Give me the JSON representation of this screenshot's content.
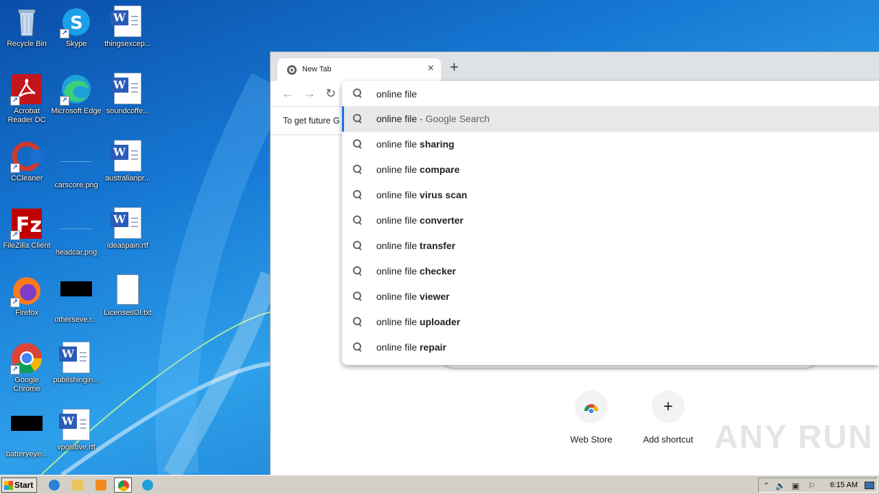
{
  "desktop": {
    "icons": [
      {
        "label": "Recycle Bin",
        "icon": "recycle-bin-icon"
      },
      {
        "label": "Skype",
        "icon": "skype-icon"
      },
      {
        "label": "thingsexcep...",
        "icon": "word-doc-icon"
      },
      {
        "label": "Acrobat Reader DC",
        "icon": "acrobat-icon"
      },
      {
        "label": "Microsoft Edge",
        "icon": "edge-icon"
      },
      {
        "label": "soundcoffe...",
        "icon": "word-doc-icon"
      },
      {
        "label": "CCleaner",
        "icon": "ccleaner-icon"
      },
      {
        "label": "carscore.png",
        "icon": "png-file-icon"
      },
      {
        "label": "australianpr...",
        "icon": "word-doc-icon"
      },
      {
        "label": "FileZilla Client",
        "icon": "filezilla-icon"
      },
      {
        "label": "headcar.png",
        "icon": "png-file-icon"
      },
      {
        "label": "ideaspain.rtf",
        "icon": "word-doc-icon"
      },
      {
        "label": "Firefox",
        "icon": "firefox-icon"
      },
      {
        "label": "otherseve r...",
        "icon": "black-file-icon"
      },
      {
        "label": "LicensesOI.txt",
        "icon": "text-file-icon"
      },
      {
        "label": "Google Chrome",
        "icon": "chrome-icon"
      },
      {
        "label": "publishingin...",
        "icon": "word-doc-icon"
      },
      {
        "label": "batteryeye...",
        "icon": "black-file-icon"
      },
      {
        "label": "vpositive.rtf",
        "icon": "word-doc-icon"
      }
    ]
  },
  "browser": {
    "tab_title": "New Tab",
    "tab_close": "×",
    "new_tab": "+",
    "infobar_text": "To get future G",
    "omnibox_value": "online file",
    "suggestions": [
      {
        "prefix": "online file",
        "bold": "",
        "suffix": " - Google Search"
      },
      {
        "prefix": "online file ",
        "bold": "sharing",
        "suffix": ""
      },
      {
        "prefix": "online file ",
        "bold": "compare",
        "suffix": ""
      },
      {
        "prefix": "online file ",
        "bold": "virus scan",
        "suffix": ""
      },
      {
        "prefix": "online file ",
        "bold": "converter",
        "suffix": ""
      },
      {
        "prefix": "online file ",
        "bold": "transfer",
        "suffix": ""
      },
      {
        "prefix": "online file ",
        "bold": "checker",
        "suffix": ""
      },
      {
        "prefix": "online file ",
        "bold": "viewer",
        "suffix": ""
      },
      {
        "prefix": "online file ",
        "bold": "uploader",
        "suffix": ""
      },
      {
        "prefix": "online file ",
        "bold": "repair",
        "suffix": ""
      }
    ],
    "shortcuts": [
      {
        "label": "Web Store"
      },
      {
        "label": "Add shortcut"
      }
    ]
  },
  "watermark": "ANY RUN",
  "taskbar": {
    "start_label": "Start",
    "clock": "6:15 AM"
  }
}
